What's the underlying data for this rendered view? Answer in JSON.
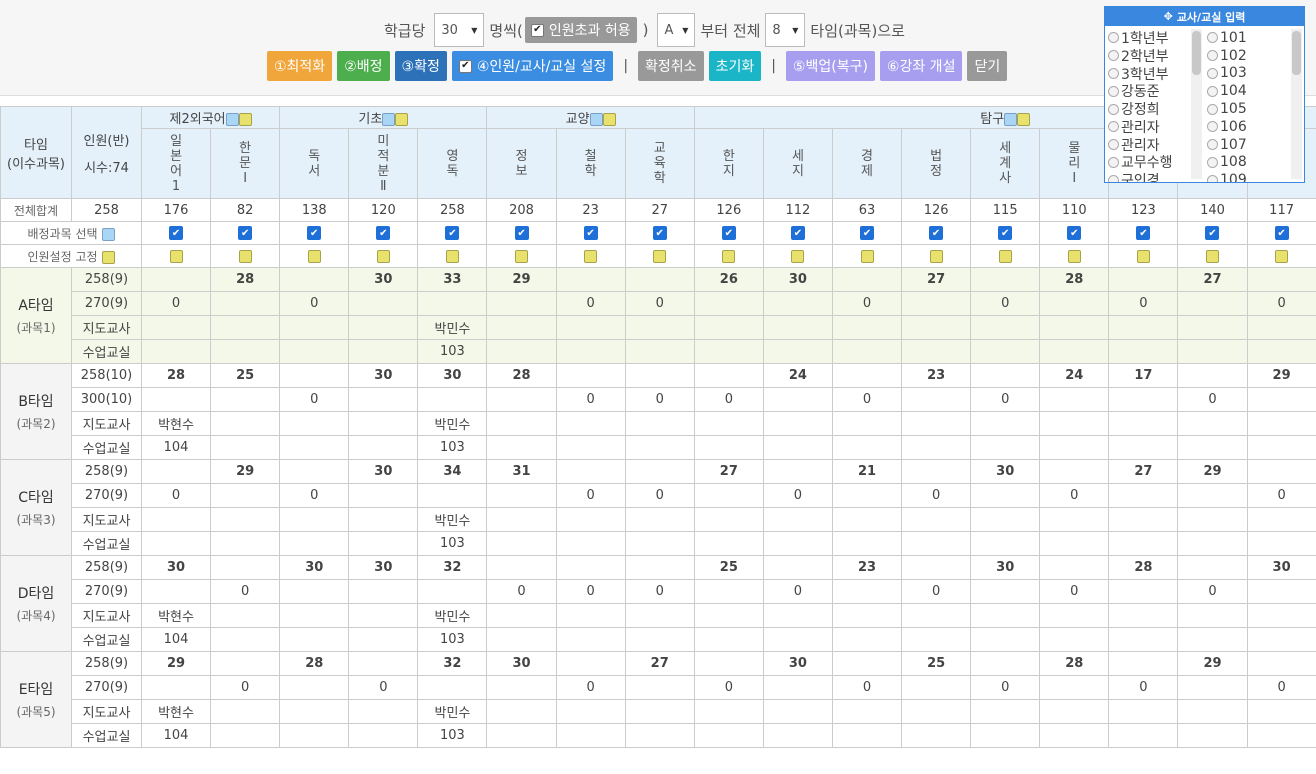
{
  "toolbar": {
    "per_class_label": "학급당",
    "per_class_value": "30",
    "people_label": "명씩(",
    "allow_over_label": "인원초과 허용",
    "close_paren": ")",
    "start_type_value": "A",
    "from_label": "부터 전체",
    "total_types_value": "8",
    "types_label": "타임(과목)으로",
    "buttons": [
      {
        "label": "①최적화",
        "color": "#f0a63a"
      },
      {
        "label": "②배정",
        "color": "#4cae4c"
      },
      {
        "label": "③확정",
        "color": "#2d72b8"
      },
      {
        "label": "④인원/교사/교실 설정",
        "color": "#3a8de0"
      },
      {
        "label": "확정취소",
        "color": "#999999"
      },
      {
        "label": "초기화",
        "color": "#1ab6c8"
      },
      {
        "label": "⑤백업(복구)",
        "color": "#a89ef0"
      },
      {
        "label": "⑥강좌 개설",
        "color": "#a89ef0"
      },
      {
        "label": "닫기",
        "color": "#999999"
      }
    ],
    "separator": "|"
  },
  "panel": {
    "title": "교사/교실 입력",
    "col1": [
      "1학년부",
      "2학년부",
      "3학년부",
      "강동준",
      "강정희",
      "관리자",
      "관리자",
      "교무수행",
      "구인경"
    ],
    "col2": [
      "101",
      "102",
      "103",
      "104",
      "105",
      "106",
      "107",
      "108",
      "109"
    ]
  },
  "table": {
    "corner1": "타임",
    "corner2": "(이수과목)",
    "count_head": "인원(반)",
    "hours": "시수:74",
    "groups": [
      {
        "name": "제2외국어",
        "span": 2
      },
      {
        "name": "기초",
        "span": 3
      },
      {
        "name": "교양",
        "span": 3
      },
      {
        "name": "탐구",
        "span": 9
      }
    ],
    "subjects": [
      "일본어1",
      "한문Ⅰ",
      "독서",
      "미적분Ⅱ",
      "영독",
      "정보",
      "철학",
      "교육학",
      "한지",
      "세지",
      "경제",
      "법정",
      "세계사",
      "물리Ⅰ",
      "",
      "",
      ""
    ],
    "total_label": "전체합계",
    "totals": [
      "258",
      "176",
      "82",
      "138",
      "120",
      "258",
      "208",
      "23",
      "27",
      "126",
      "112",
      "63",
      "126",
      "115",
      "110",
      "123",
      "140",
      "117"
    ],
    "select_label": "배정과목 선택",
    "fix_label": "인원설정 고정",
    "row_labels": {
      "teacher": "지도교사",
      "room": "수업교실"
    },
    "types": [
      {
        "name": "A타임",
        "sub": "(과목1)",
        "count": "258(9)",
        "cap": "270(9)",
        "vals": [
          "",
          "28",
          "",
          "30",
          "33",
          "29",
          "",
          "",
          "26",
          "30",
          "",
          "27",
          "",
          "28",
          "",
          "27",
          ""
        ],
        "caps": [
          "0",
          "",
          "0",
          "",
          "",
          "",
          "0",
          "0",
          "",
          "",
          "0",
          "",
          "0",
          "",
          "0",
          "",
          "0"
        ],
        "teacher": [
          "",
          "",
          "",
          "",
          "박민수",
          "",
          "",
          "",
          "",
          "",
          "",
          "",
          "",
          "",
          "",
          "",
          ""
        ],
        "room": [
          "",
          "",
          "",
          "",
          "103",
          "",
          "",
          "",
          "",
          "",
          "",
          "",
          "",
          "",
          "",
          "",
          ""
        ]
      },
      {
        "name": "B타임",
        "sub": "(과목2)",
        "count": "258(10)",
        "cap": "300(10)",
        "vals": [
          "28",
          "25",
          "",
          "30",
          "30",
          "28",
          "",
          "",
          "",
          "24",
          "",
          "23",
          "",
          "24",
          "17",
          "",
          "29"
        ],
        "caps": [
          "",
          "",
          "0",
          "",
          "",
          "",
          "0",
          "0",
          "0",
          "",
          "0",
          "",
          "0",
          "",
          "",
          "0",
          ""
        ],
        "teacher": [
          "박현수",
          "",
          "",
          "",
          "박민수",
          "",
          "",
          "",
          "",
          "",
          "",
          "",
          "",
          "",
          "",
          "",
          ""
        ],
        "room": [
          "104",
          "",
          "",
          "",
          "103",
          "",
          "",
          "",
          "",
          "",
          "",
          "",
          "",
          "",
          "",
          "",
          ""
        ]
      },
      {
        "name": "C타임",
        "sub": "(과목3)",
        "count": "258(9)",
        "cap": "270(9)",
        "vals": [
          "",
          "29",
          "",
          "30",
          "34",
          "31",
          "",
          "",
          "27",
          "",
          "21",
          "",
          "30",
          "",
          "27",
          "29",
          ""
        ],
        "caps": [
          "0",
          "",
          "0",
          "",
          "",
          "",
          "0",
          "0",
          "",
          "0",
          "",
          "0",
          "",
          "0",
          "",
          "",
          "0"
        ],
        "teacher": [
          "",
          "",
          "",
          "",
          "박민수",
          "",
          "",
          "",
          "",
          "",
          "",
          "",
          "",
          "",
          "",
          "",
          ""
        ],
        "room": [
          "",
          "",
          "",
          "",
          "103",
          "",
          "",
          "",
          "",
          "",
          "",
          "",
          "",
          "",
          "",
          "",
          ""
        ]
      },
      {
        "name": "D타임",
        "sub": "(과목4)",
        "count": "258(9)",
        "cap": "270(9)",
        "vals": [
          "30",
          "",
          "30",
          "30",
          "32",
          "",
          "",
          "",
          "25",
          "",
          "23",
          "",
          "30",
          "",
          "28",
          "",
          "30"
        ],
        "caps": [
          "",
          "0",
          "",
          "",
          "",
          "0",
          "0",
          "0",
          "",
          "0",
          "",
          "0",
          "",
          "0",
          "",
          "0",
          ""
        ],
        "teacher": [
          "박현수",
          "",
          "",
          "",
          "박민수",
          "",
          "",
          "",
          "",
          "",
          "",
          "",
          "",
          "",
          "",
          "",
          ""
        ],
        "room": [
          "104",
          "",
          "",
          "",
          "103",
          "",
          "",
          "",
          "",
          "",
          "",
          "",
          "",
          "",
          "",
          "",
          ""
        ]
      },
      {
        "name": "E타임",
        "sub": "(과목5)",
        "count": "258(9)",
        "cap": "270(9)",
        "vals": [
          "29",
          "",
          "28",
          "",
          "32",
          "30",
          "",
          "27",
          "",
          "30",
          "",
          "25",
          "",
          "28",
          "",
          "29",
          ""
        ],
        "caps": [
          "",
          "0",
          "",
          "0",
          "",
          "",
          "0",
          "",
          "0",
          "",
          "0",
          "",
          "0",
          "",
          "0",
          "",
          "0"
        ],
        "teacher": [
          "박현수",
          "",
          "",
          "",
          "박민수",
          "",
          "",
          "",
          "",
          "",
          "",
          "",
          "",
          "",
          "",
          "",
          ""
        ],
        "room": [
          "104",
          "",
          "",
          "",
          "103",
          "",
          "",
          "",
          "",
          "",
          "",
          "",
          "",
          "",
          "",
          "",
          ""
        ]
      }
    ]
  }
}
